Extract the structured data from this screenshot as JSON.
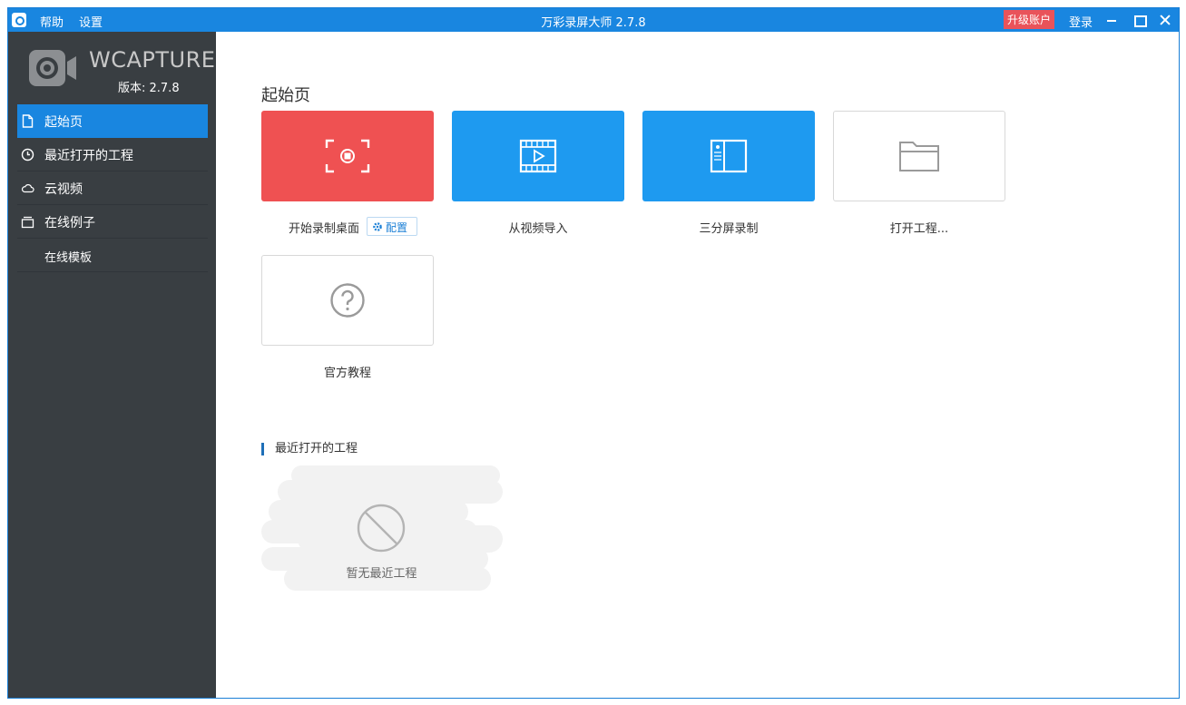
{
  "titlebar": {
    "menu_help": "帮助",
    "menu_settings": "设置",
    "title": "万彩录屏大师 2.7.8",
    "upgrade_label": "升级账户",
    "login_label": "登录"
  },
  "sidebar": {
    "brand_name": "WCAPTURE",
    "version": "版本: 2.7.8",
    "items": [
      {
        "label": "起始页",
        "icon": "document-icon",
        "active": true
      },
      {
        "label": "最近打开的工程",
        "icon": "clock-icon"
      },
      {
        "label": "云视频",
        "icon": "cloud-icon"
      },
      {
        "label": "在线例子",
        "icon": "stack-icon"
      },
      {
        "label": "在线模板",
        "icon": ""
      }
    ]
  },
  "main": {
    "page_title": "起始页",
    "cards": [
      {
        "label": "开始录制桌面",
        "icon": "record-screen-icon",
        "color": "#ef5152"
      },
      {
        "label": "从视频导入",
        "icon": "film-import-icon",
        "color": "#1e9af0"
      },
      {
        "label": "三分屏录制",
        "icon": "split-screen-icon",
        "color": "#1e9af0"
      },
      {
        "label": "打开工程...",
        "icon": "folder-icon",
        "color": "#ffffff"
      },
      {
        "label": "官方教程",
        "icon": "help-icon",
        "color": "#ffffff"
      }
    ],
    "config_label": "配置",
    "recent_title": "最近打开的工程",
    "empty_text": "暂无最近工程"
  },
  "colors": {
    "accent": "#1986e0",
    "sidebar_bg": "#393e42",
    "upgrade": "#e9535a"
  }
}
